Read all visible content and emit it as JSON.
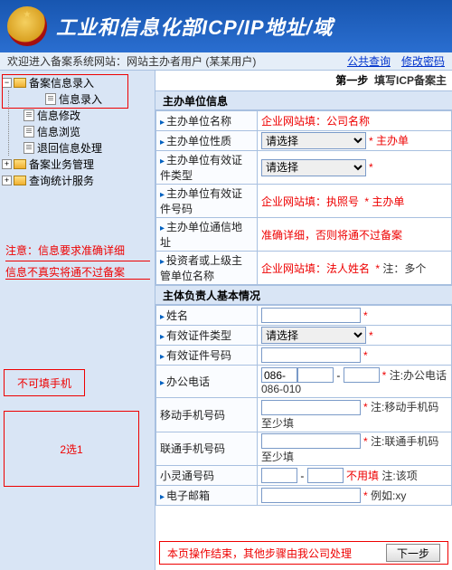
{
  "header": {
    "title": "工业和信息化部ICP/IP地址/域"
  },
  "topbar": {
    "welcome_prefix": "欢迎进入备案系统网站：网站主办者用户",
    "welcome_user": "(某某用户)",
    "link_public": "公共查询",
    "link_pwd": "修改密码"
  },
  "tree": {
    "root1": "备案信息录入",
    "root1_child": "信息录入",
    "item_modify": "信息修改",
    "item_browse": "信息浏览",
    "item_return": "退回信息处理",
    "root2": "备案业务管理",
    "root3": "查询统计服务"
  },
  "notes": {
    "n1": "注意：信息要求准确详细",
    "n2": "信息不真实将通不过备案",
    "n3": "不可填手机",
    "n4": "2选1"
  },
  "step": {
    "prefix": "第一步",
    "text": "填写ICP备案主"
  },
  "sections": {
    "s1": "主办单位信息",
    "s2": "主体负责人基本情况"
  },
  "fields": {
    "unit_name_lbl": "主办单位名称",
    "unit_name_hint": "企业网站填：公司名称",
    "unit_nature_lbl": "主办单位性质",
    "unit_nature_rt": "主办单",
    "cert_type_lbl": "主办单位有效证件类型",
    "cert_no_lbl": "主办单位有效证件号码",
    "cert_no_hint": "企业网站填：执照号",
    "cert_no_rt": "主办单",
    "addr_lbl": "主办单位通信地址",
    "addr_hint": "准确详细，否则将通不过备案",
    "investor_lbl": "投资者或上级主管单位名称",
    "investor_hint": "企业网站填：法人姓名",
    "investor_rt": "注：多个",
    "name_lbl": "姓名",
    "idtype_lbl": "有效证件类型",
    "idno_lbl": "有效证件号码",
    "office_phone_lbl": "办公电话",
    "office_phone_val": "086-",
    "office_phone_rt": "注:办公电话086-010",
    "mobile_lbl": "移动手机号码",
    "mobile_rt": "注:移动手机码至少填",
    "unicom_lbl": "联通手机号码",
    "unicom_rt": "注:联通手机码至少填",
    "phs_lbl": "小灵通号码",
    "phs_hint": "不用填",
    "phs_rt": "注:该项",
    "email_lbl": "电子邮箱",
    "email_rt": "例如:xy",
    "select_default": "请选择"
  },
  "footer": {
    "text": "本页操作结束，其他步骤由我公司处理",
    "next": "下一步"
  }
}
